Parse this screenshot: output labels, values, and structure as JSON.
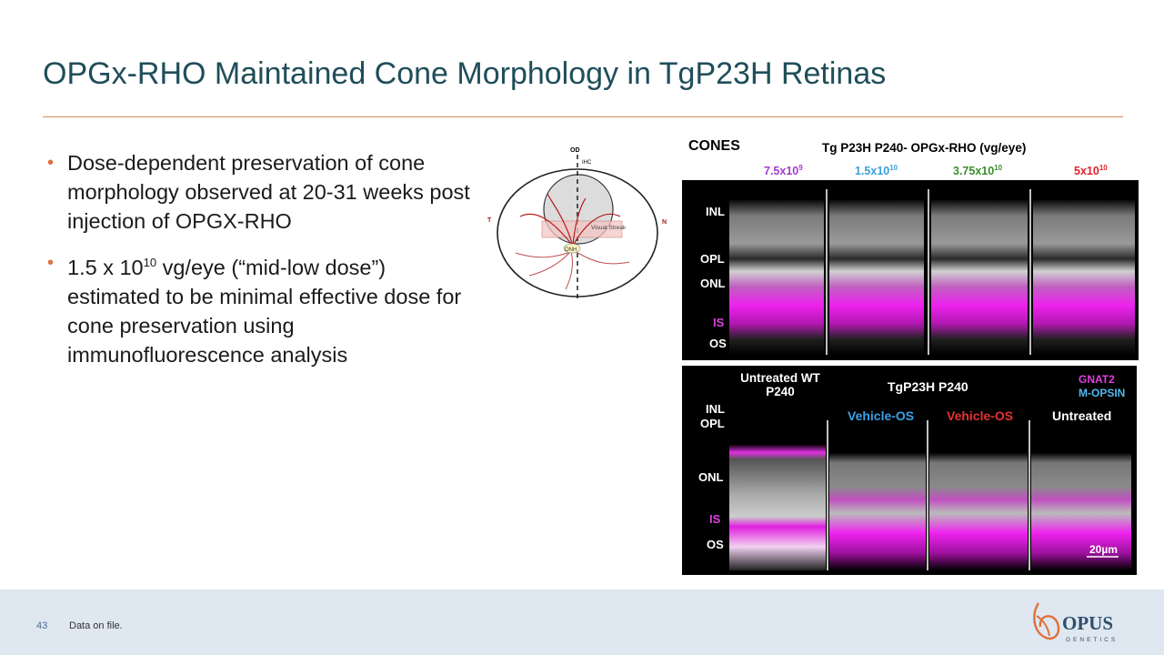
{
  "slide": {
    "title": "OPGx-RHO Maintained Cone Morphology in TgP23H Retinas",
    "page_number": "43",
    "footnote": "Data on file.",
    "bullets": [
      {
        "text": "Dose-dependent preservation of cone morphology observed at 20-31 weeks post injection of OPGX-RHO"
      },
      {
        "pre": "1.5 x 10",
        "sup": "10",
        "post": " vg/eye (“mid-low dose”) estimated to be minimal effective dose for cone preservation using immunofluorescence analysis"
      }
    ]
  },
  "diagram": {
    "labels": {
      "od": "OD",
      "ihc": "IHC",
      "t": "T",
      "n": "N",
      "streak": "Visual Streak",
      "onh": "ONH"
    }
  },
  "top_panel": {
    "heading": "CONES",
    "title": "Tg P23H P240- OPGx-RHO (vg/eye)",
    "doses": [
      {
        "base": "7.5x10",
        "exp": "9",
        "color": "#a33bd0"
      },
      {
        "base": "1.5x10",
        "exp": "10",
        "color": "#3aa0d8"
      },
      {
        "base": "3.75x10",
        "exp": "10",
        "color": "#3a8f2a"
      },
      {
        "base": "5x10",
        "exp": "10",
        "color": "#e0202a"
      }
    ],
    "layers": [
      "INL",
      "OPL",
      "ONL",
      "IS",
      "OS"
    ]
  },
  "bottom_panel": {
    "col1_label": "Untreated WT P240",
    "title": "TgP23H P240",
    "legend": [
      {
        "text": "GNAT2",
        "color": "#e040e0"
      },
      {
        "text": "M-OPSIN",
        "color": "#50b8f0"
      }
    ],
    "groups": [
      {
        "text": "Vehicle-OS",
        "color": "#3aa0e8"
      },
      {
        "text": "Vehicle-OS",
        "color": "#e83030"
      },
      {
        "text": "Untreated",
        "color": "#ffffff"
      }
    ],
    "layers": [
      "INL",
      "OPL",
      "ONL",
      "IS",
      "OS"
    ],
    "scale": "20µm"
  },
  "logo": {
    "name": "OPUS",
    "sub": "GENETICS"
  }
}
